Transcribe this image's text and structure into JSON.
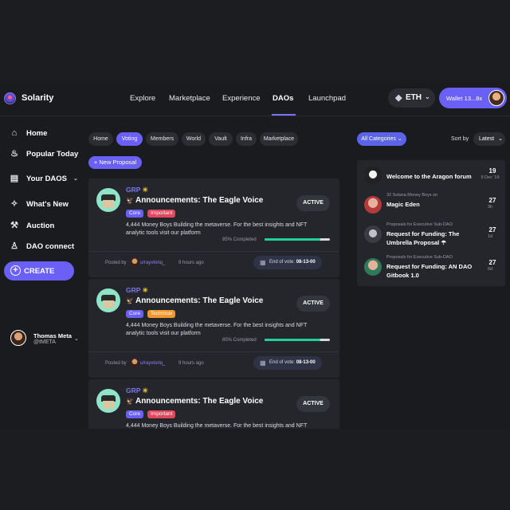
{
  "brand": {
    "name": "Solarity"
  },
  "nav": [
    "Explore",
    "Marketplace",
    "Experience",
    "DAOs",
    "Launchpad"
  ],
  "nav_active": "DAOs",
  "network": {
    "label": "ETH"
  },
  "wallet": {
    "label": "Wallet 13...8x"
  },
  "sidebar": {
    "items": [
      {
        "label": "Home",
        "icon": "home-icon"
      },
      {
        "label": "Popular Today",
        "icon": "flame-icon"
      },
      {
        "label": "Your DAOS",
        "icon": "document-icon"
      },
      {
        "label": "What's New",
        "icon": "sparkle-icon"
      },
      {
        "label": "Auction",
        "icon": "gavel-icon"
      },
      {
        "label": "DAO connect",
        "icon": "person-icon"
      }
    ],
    "create_label": "CREATE",
    "user": {
      "name": "Thomas Meta",
      "handle": "@tMETA"
    }
  },
  "filters": [
    "Home",
    "Voting",
    "Members",
    "World",
    "Vault",
    "Infra",
    "Marketplace"
  ],
  "filter_active": "Voting",
  "new_proposal_label": "+ New Proposal",
  "proposals": [
    {
      "group": "GRP",
      "title": "Announcements: The Eagle Voice",
      "tags": [
        "Core",
        "Important"
      ],
      "description": "4,444 Money Boys Building the metaverse. For the best insights and NFT analytic tools visit our platform",
      "status": "ACTIVE",
      "progress_label": "85% Completed",
      "progress": 0.85,
      "posted_by_label": "Posted by",
      "author": "u/rayvtoriq_",
      "time_ago": "9 hours ago",
      "end_label": "End of vote:",
      "end_value": "08-13-00"
    },
    {
      "group": "GRP",
      "title": "Announcements: The Eagle Voice",
      "tags": [
        "Core",
        "Technical"
      ],
      "description": "4,444 Money Boys Building the metaverse. For the best insights and NFT analytic tools visit our platform",
      "status": "ACTIVE",
      "progress_label": "85% Completed",
      "progress": 0.85,
      "posted_by_label": "Posted by",
      "author": "u/rayvtoriq_",
      "time_ago": "9 hours ago",
      "end_label": "End of vote:",
      "end_value": "08-13-00"
    },
    {
      "group": "GRP",
      "title": "Announcements: The Eagle Voice",
      "tags": [
        "Core",
        "Important"
      ],
      "description": "4,444 Money Boys Building the metaverse. For the best insights and NFT analytic",
      "status": "ACTIVE"
    }
  ],
  "right": {
    "category_label": "All Categories",
    "sort_label": "Sort by",
    "sort_value": "Latest",
    "feed": [
      {
        "subtitle": "",
        "title": "Welcome to the Aragon forum",
        "count": "19",
        "date": "9 Dec '19"
      },
      {
        "subtitle": "32 Solana Money Boys on",
        "title": "Magic Eden",
        "count": "27",
        "date": "3h"
      },
      {
        "subtitle": "Proposals for Executive Sub-DAO",
        "title": "Request for Funding: The Umbrella Proposal ☂",
        "count": "27",
        "date": "1d"
      },
      {
        "subtitle": "Proposals for Executive Sub-DAO",
        "title": "Request for Funding: AN DAO Gitbook 1.0",
        "count": "27",
        "date": "6d"
      }
    ]
  }
}
